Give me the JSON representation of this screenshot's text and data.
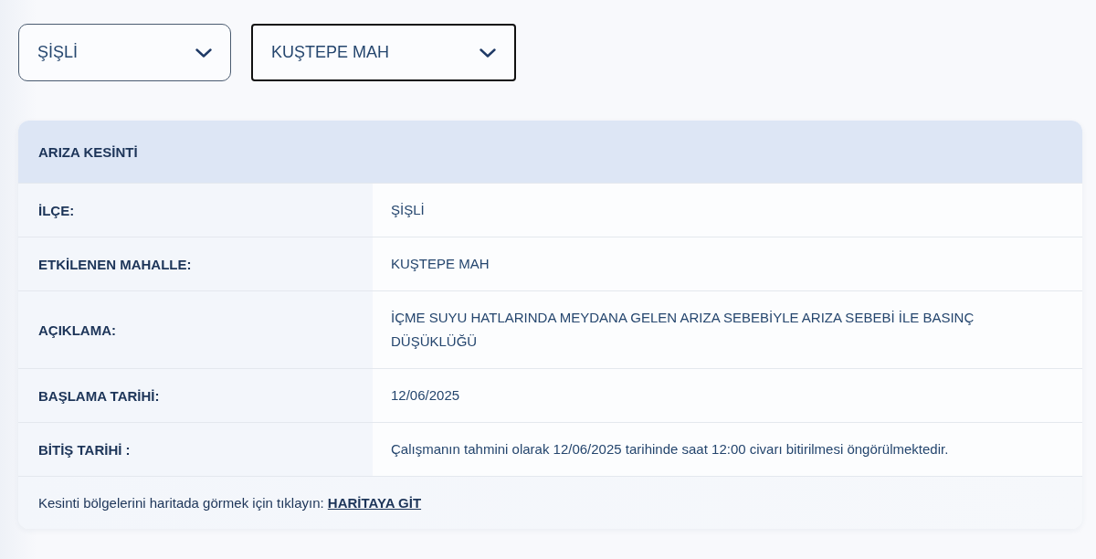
{
  "filters": [
    {
      "value": "ŞİŞLİ",
      "focused": false
    },
    {
      "value": "KUŞTEPE MAH",
      "focused": true
    }
  ],
  "card": {
    "title": "ARIZA KESİNTİ",
    "rows": [
      {
        "label": "İLÇE:",
        "value": "ŞİŞLİ"
      },
      {
        "label": "ETKİLENEN MAHALLE:",
        "value": "KUŞTEPE MAH"
      },
      {
        "label": "AÇIKLAMA:",
        "value": "İÇME SUYU HATLARINDA MEYDANA GELEN ARIZA SEBEBİYLE ARIZA SEBEBİ İLE BASINÇ DÜŞÜKLÜĞÜ"
      },
      {
        "label": "BAŞLAMA TARİHİ:",
        "value": "12/06/2025"
      },
      {
        "label": "BİTİŞ TARİHİ :",
        "value": "Çalışmanın tahmini olarak 12/06/2025 tarihinde saat 12:00 civarı bitirilmesi öngörülmektedir."
      }
    ],
    "footer": {
      "text": "Kesinti bölgelerini haritada görmek için tıklayın:",
      "link": "HARİTAYA GİT"
    }
  }
}
